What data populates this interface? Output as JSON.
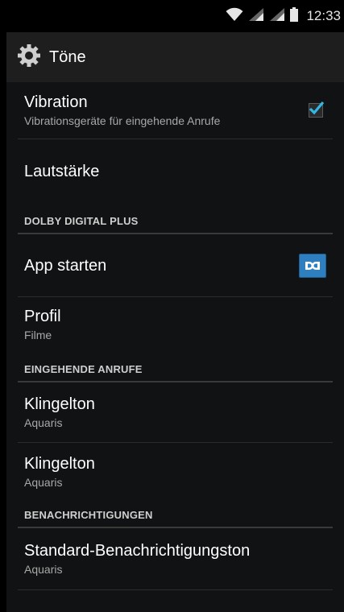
{
  "status_bar": {
    "time": "12:33",
    "icons": [
      "wifi-icon",
      "signal-icon",
      "signal-icon",
      "battery-icon"
    ]
  },
  "action_bar": {
    "icon": "gear-icon",
    "title": "Töne"
  },
  "items": {
    "vibration": {
      "title": "Vibration",
      "summary": "Vibrationsgeräte für eingehende Anrufe",
      "checked": true
    },
    "volume": {
      "title": "Lautstärke"
    },
    "app_start": {
      "title": "App starten",
      "icon": "dolby-icon"
    },
    "profile": {
      "title": "Profil",
      "summary": "Filme"
    },
    "ringtone1": {
      "title": "Klingelton",
      "summary": "Aquaris"
    },
    "ringtone2": {
      "title": "Klingelton",
      "summary": "Aquaris"
    },
    "notification": {
      "title": "Standard-Benachrichtigungston",
      "summary": "Aquaris"
    }
  },
  "categories": {
    "dolby": "DOLBY DIGITAL PLUS",
    "incoming": "EINGEHENDE ANRUFE",
    "notifications": "BENACHRICHTIGUNGEN"
  },
  "colors": {
    "accent": "#33b5e5",
    "background": "#111213",
    "dolby_blue": "#2d7fc0"
  }
}
